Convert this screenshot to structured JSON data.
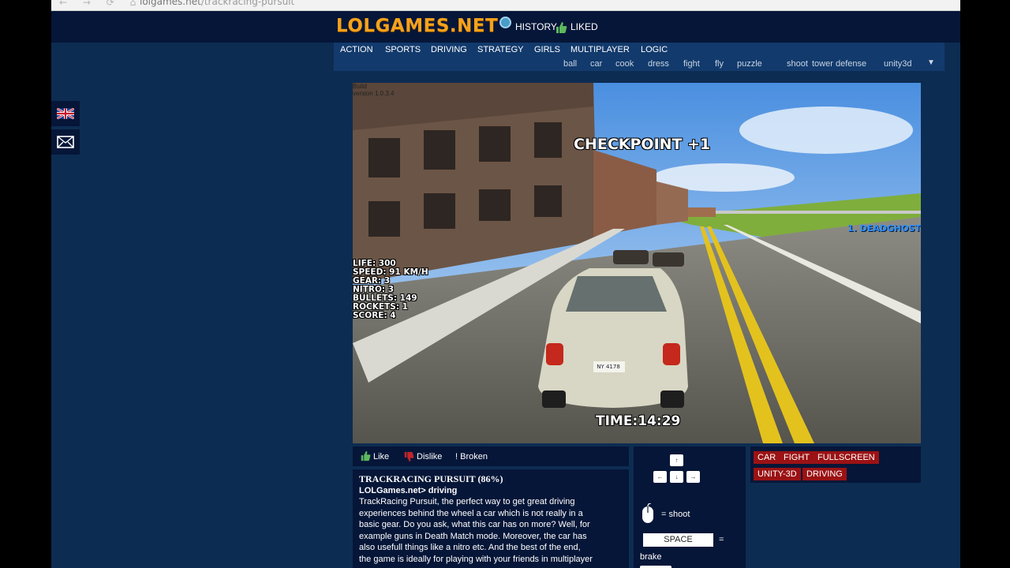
{
  "browser": {
    "nav_glyphs": "← → ⟳ ⌂",
    "url_host": "lolgames.net",
    "url_path": "/trackracing-pursuit"
  },
  "header": {
    "logo": "LOLGAMES.NET",
    "history": "HISTORY",
    "liked": "LIKED"
  },
  "nav": {
    "categories": [
      "ACTION",
      "SPORTS",
      "DRIVING",
      "STRATEGY",
      "GIRLS",
      "MULTIPLAYER",
      "LOGIC"
    ],
    "tags": [
      "ball",
      "car",
      "cook",
      "dress",
      "fight",
      "fly",
      "puzzle",
      "shoot",
      "tower defense",
      "unity3d"
    ],
    "more": "▼"
  },
  "game": {
    "debug_line1": "Build",
    "debug_line2": "version 1.0.3.4",
    "checkpoint": "CHECKPOINT +1",
    "player": "1. DEADGHOST",
    "stats": [
      "LIFE: 300",
      "SPEED: 91 KM/H",
      "GEAR: 3",
      "NITRO: 3",
      "BULLETS: 149",
      "ROCKETS: 1",
      "SCORE: 4"
    ],
    "timer": "TIME:14:29",
    "plate": "NY 4178"
  },
  "actions": {
    "like": "Like",
    "dislike": "Dislike",
    "broken": "! Broken"
  },
  "description": {
    "title": "TRACKRACING PURSUIT (86%)",
    "crumb": "LOLGames.net> driving",
    "lines": [
      "TrackRacing Pursuit, the perfect way to get great driving",
      "experiences behind the wheel a car which is not really in a",
      "basic gear. Do you ask, what this car has on more? Well, for",
      "example guns in Death Match mode. Moreover, the car has",
      "also usefull things like a nitro etc. And the best of the end,",
      "the game is ideally for playing with your friends in multiplayer"
    ]
  },
  "controls": {
    "up": "↑",
    "left": "←",
    "down": "↓",
    "right": "→",
    "shoot": "= shoot",
    "space": "SPACE",
    "eq": "=",
    "brake": "brake"
  },
  "game_tags": [
    "CAR",
    "FIGHT",
    "FULLSCREEN",
    "UNITY-3D",
    "DRIVING"
  ],
  "colors": {
    "page_bg": "#0d2c52",
    "header_bg": "#061638",
    "nav_bg": "#123a6c",
    "logo": "#f5a21b",
    "tag_red": "#9b1214"
  }
}
